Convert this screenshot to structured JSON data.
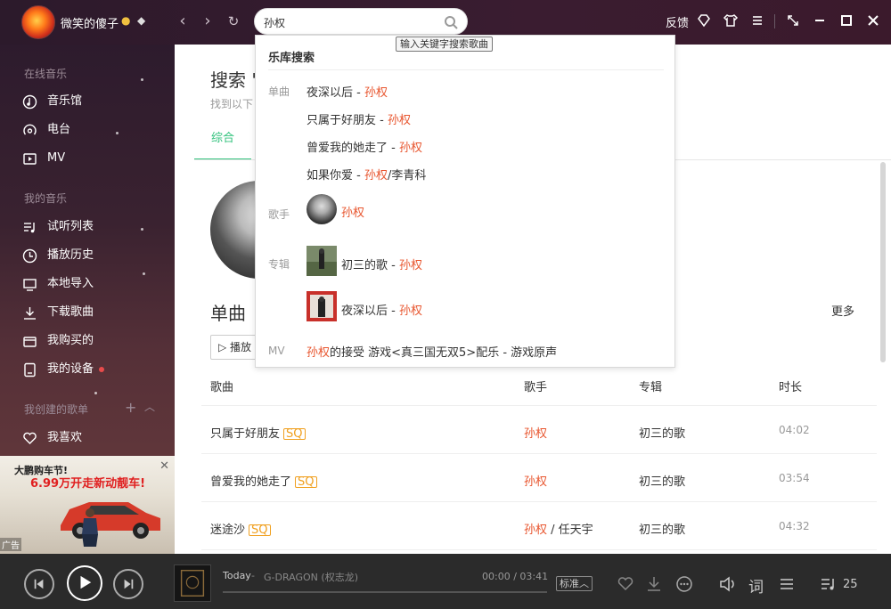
{
  "titlebar": {
    "username": "微笑的傻子",
    "search_value": "孙权",
    "feedback": "反馈"
  },
  "tooltip": "输入关键字搜索歌曲",
  "sidebar": {
    "section_online": "在线音乐",
    "online_items": [
      {
        "label": "音乐馆"
      },
      {
        "label": "电台"
      },
      {
        "label": "MV"
      }
    ],
    "section_my": "我的音乐",
    "my_items": [
      {
        "label": "试听列表"
      },
      {
        "label": "播放历史"
      },
      {
        "label": "本地导入"
      },
      {
        "label": "下载歌曲"
      },
      {
        "label": "我购买的"
      },
      {
        "label": "我的设备"
      }
    ],
    "section_created": "我创建的歌单",
    "created_items": [
      {
        "label": "我喜欢"
      }
    ],
    "ad": {
      "line1": "大鹏购车节!",
      "line2": "6.99万开走新动靓车!",
      "label": "广告"
    }
  },
  "main": {
    "title": "搜索 \"",
    "subtitle": "找到以下",
    "tab_active": "综合",
    "single_title": "单曲",
    "more": "更多",
    "play_all": "播放",
    "headers": {
      "song": "歌曲",
      "artist": "歌手",
      "album": "专辑",
      "duration": "时长"
    },
    "badge": "SQ",
    "rows": [
      {
        "song": "只属于好朋友",
        "artist": "孙权",
        "artist2": "",
        "album": "初三的歌",
        "duration": "04:02"
      },
      {
        "song": "曾爱我的她走了",
        "artist": "孙权",
        "artist2": "",
        "album": "初三的歌",
        "duration": "03:54"
      },
      {
        "song": "迷途沙",
        "artist": "孙权",
        "artist2": " / 任天宇",
        "album": "初三的歌",
        "duration": "04:32"
      }
    ]
  },
  "dropdown": {
    "header": "乐库搜索",
    "cat_song": "单曲",
    "cat_singer": "歌手",
    "cat_album": "专辑",
    "cat_mv": "MV",
    "songs": [
      {
        "title": "夜深以后",
        "sep": " - ",
        "artist": "孙权",
        "extra": ""
      },
      {
        "title": "只属于好朋友",
        "sep": " - ",
        "artist": "孙权",
        "extra": ""
      },
      {
        "title": "曾爱我的她走了",
        "sep": " - ",
        "artist": "孙权",
        "extra": ""
      },
      {
        "title": "如果你爱",
        "sep": " - ",
        "artist": "孙权",
        "extra": "/李青科"
      }
    ],
    "singer": "孙权",
    "albums": [
      {
        "title": "初三的歌",
        "sep": " - ",
        "artist": "孙权"
      },
      {
        "title": "夜深以后",
        "sep": " - ",
        "artist": "孙权"
      }
    ],
    "mv": {
      "hl": "孙权",
      "rest": "的接受 游戏<真三国无双5>配乐 - 游戏原声"
    }
  },
  "player": {
    "track": "Today",
    "sep": " - ",
    "artist": "G-DRAGON (权志龙)",
    "time": "00:00 / 03:41",
    "quality": "标准",
    "lyrics": "词",
    "count": "25",
    "progress": 0
  }
}
